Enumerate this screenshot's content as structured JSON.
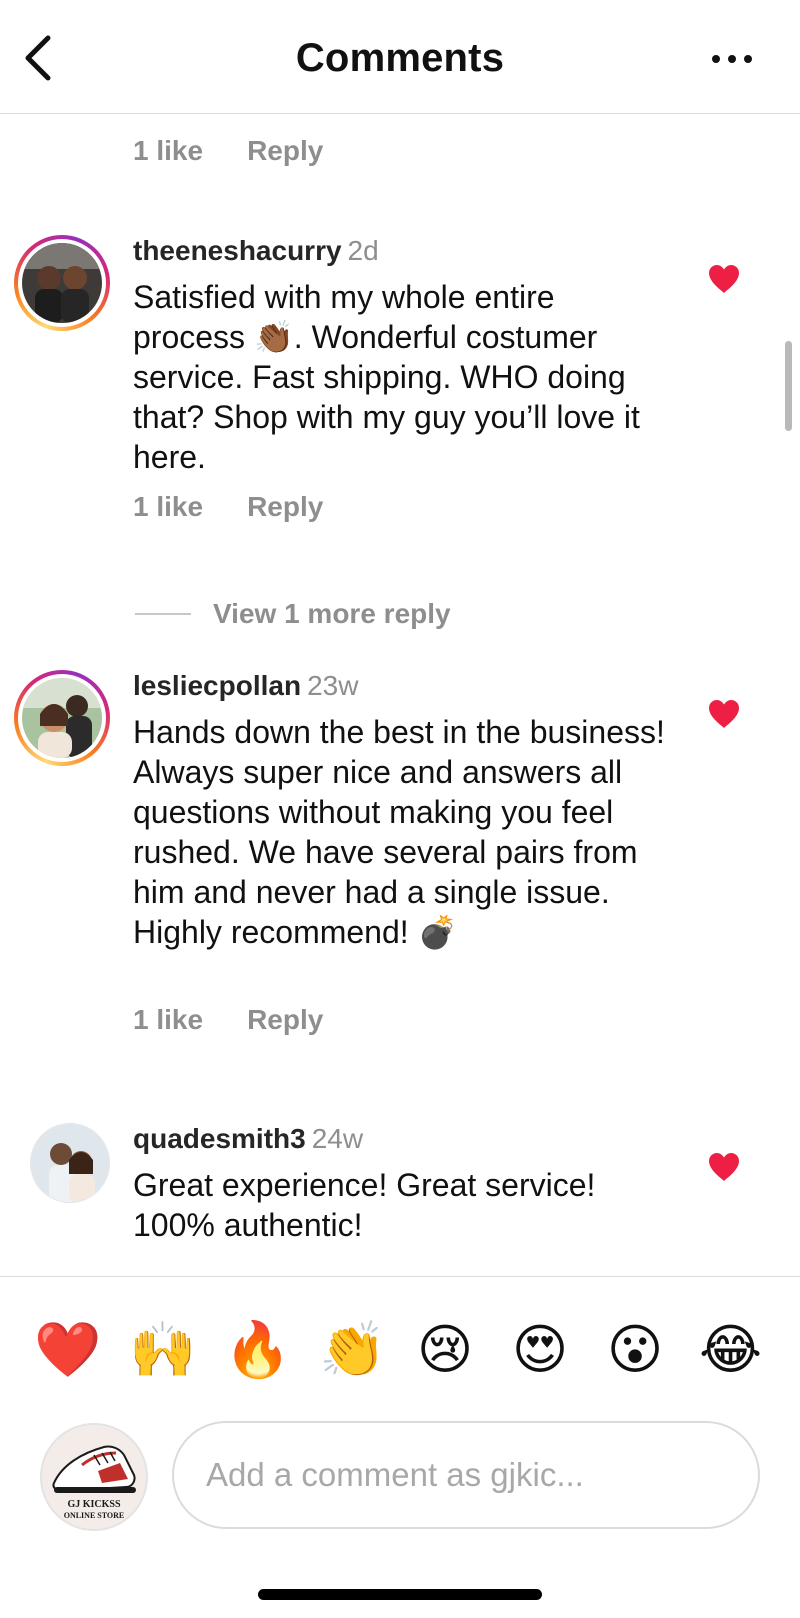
{
  "header": {
    "title": "Comments"
  },
  "top_meta": {
    "likes": "1 like",
    "reply": "Reply"
  },
  "comments": [
    {
      "username": "theeneshacurry",
      "time": "2d",
      "text": "Satisfied with my whole entire process 👏🏾. Wonderful costumer service. Fast shipping. WHO doing that? Shop with my guy you’ll love it here.",
      "likes": "1 like",
      "reply": "Reply",
      "liked": true,
      "story_ring": true
    },
    {
      "username": "lesliecpollan",
      "time": "23w",
      "text": "Hands down the best in the business! Always super nice and answers all questions without making you feel rushed. We have several pairs from him and never had a single issue. Highly recommend! 💣",
      "likes": "1 like",
      "reply": "Reply",
      "liked": true,
      "story_ring": true
    },
    {
      "username": "quadesmith3",
      "time": "24w",
      "text": "Great experience! Great service! 100% authentic!",
      "liked": true,
      "story_ring": false
    }
  ],
  "view_more": {
    "label": "View 1 more reply"
  },
  "reactions": [
    "❤️",
    "🙌",
    "🔥",
    "👏",
    "😢",
    "😍",
    "😮",
    "😂"
  ],
  "composer": {
    "placeholder": "Add a comment as gjkic...",
    "avatar_text_1": "GJ KICKSS",
    "avatar_text_2": "ONLINE STORE"
  },
  "colors": {
    "heart": "#ed1f45",
    "muted": "#8e8e8e",
    "ring_start": "#feda75",
    "ring_end": "#962fbf"
  },
  "icons": {
    "back": "chevron-left-icon",
    "more": "more-horizontal-icon",
    "heart": "heart-filled-icon"
  }
}
